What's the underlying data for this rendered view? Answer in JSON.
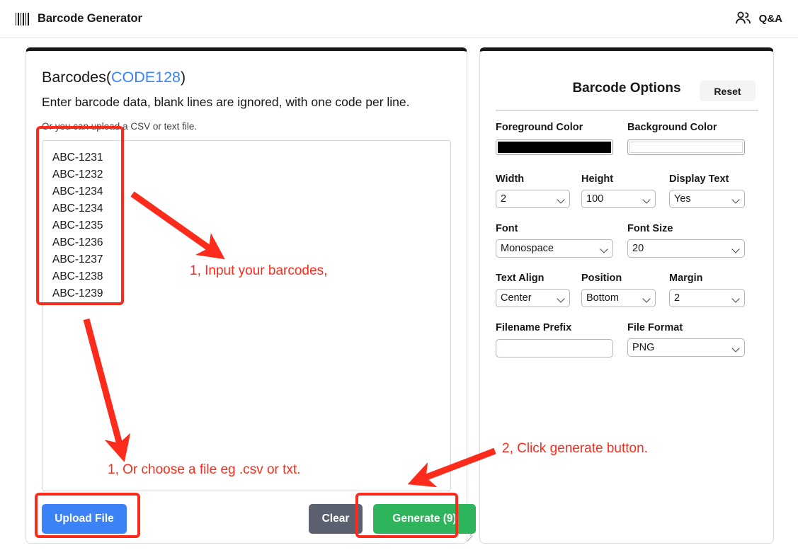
{
  "topbar": {
    "brand_icon": "barcode-icon",
    "title": "Barcode Generator",
    "qa_icon": "people-icon",
    "qa_label": "Q&A"
  },
  "left_panel": {
    "heading_prefix": "Barcodes(",
    "heading_link": "CODE128",
    "heading_suffix": ")",
    "description": "Enter barcode data, blank lines are ignored, with one code per line.",
    "subtext": "Or you can upload a CSV or text file.",
    "textarea": {
      "value": "ABC-1231\nABC-1232\nABC-1234\nABC-1234\nABC-1235\nABC-1236\nABC-1237\nABC-1238\nABC-1239",
      "placeholder": ""
    },
    "buttons": {
      "upload": "Upload File",
      "clear": "Clear",
      "generate": "Generate (9)"
    }
  },
  "right_panel": {
    "title": "Barcode Options",
    "reset_label": "Reset",
    "fields": {
      "foreground_color": {
        "label": "Foreground Color",
        "value": "#000000"
      },
      "background_color": {
        "label": "Background Color",
        "value": "#ffffff"
      },
      "width": {
        "label": "Width",
        "value": "2"
      },
      "height": {
        "label": "Height",
        "value": "100"
      },
      "display_text": {
        "label": "Display Text",
        "value": "Yes"
      },
      "font": {
        "label": "Font",
        "value": "Monospace"
      },
      "font_size": {
        "label": "Font Size",
        "value": "20"
      },
      "text_align": {
        "label": "Text Align",
        "value": "Center"
      },
      "position": {
        "label": "Position",
        "value": "Bottom"
      },
      "margin": {
        "label": "Margin",
        "value": "2"
      },
      "filename_prefix": {
        "label": "Filename Prefix",
        "value": "",
        "placeholder": ""
      },
      "file_format": {
        "label": "File Format",
        "value": "PNG"
      }
    }
  },
  "annotations": {
    "color": "#fc2b1b",
    "step1_input": "1, Input your barcodes,",
    "step1_file": "1, Or choose a file eg .csv or txt.",
    "step2_generate": "2, Click generate button."
  }
}
